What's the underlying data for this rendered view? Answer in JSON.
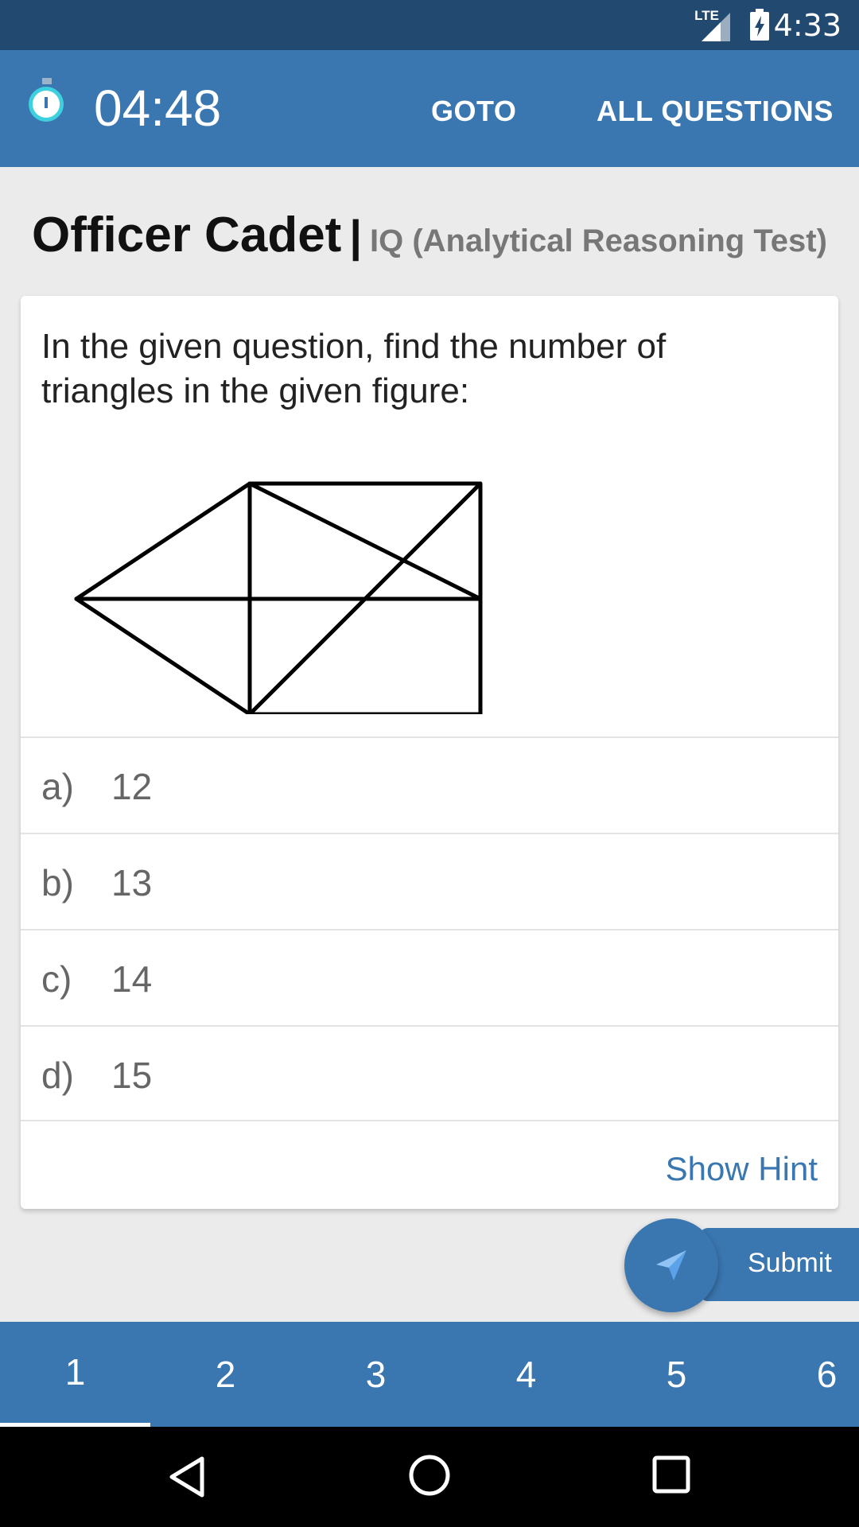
{
  "status_bar": {
    "time": "4:33",
    "network": "LTE",
    "icons": [
      "signal-icon",
      "battery-charging-icon"
    ]
  },
  "app_bar": {
    "timer": "04:48",
    "goto_label": "GOTO",
    "all_questions_label": "ALL QUESTIONS",
    "icons": [
      "stopwatch-icon"
    ]
  },
  "heading": {
    "title": "Officer Cadet",
    "separator": "|",
    "subtitle": "IQ (Analytical Reasoning Test)"
  },
  "question": {
    "text": "In the given question, find the number of triangles in the given figure:"
  },
  "options": [
    {
      "letter": "a)",
      "value": "12"
    },
    {
      "letter": "b)",
      "value": "13"
    },
    {
      "letter": "c)",
      "value": "14"
    },
    {
      "letter": "d)",
      "value": "15"
    }
  ],
  "hint": {
    "label": "Show Hint"
  },
  "submit": {
    "label": "Submit",
    "icon": "send-icon"
  },
  "tabs": [
    {
      "label": "1",
      "active": true
    },
    {
      "label": "2"
    },
    {
      "label": "3"
    },
    {
      "label": "4"
    },
    {
      "label": "5"
    },
    {
      "label": "6"
    }
  ],
  "nav_bar": {
    "icons": [
      "back-icon",
      "home-icon",
      "recents-icon"
    ]
  },
  "colors": {
    "primary": "#3a76b0",
    "status_bar": "#22496f",
    "background": "#ebebeb"
  }
}
